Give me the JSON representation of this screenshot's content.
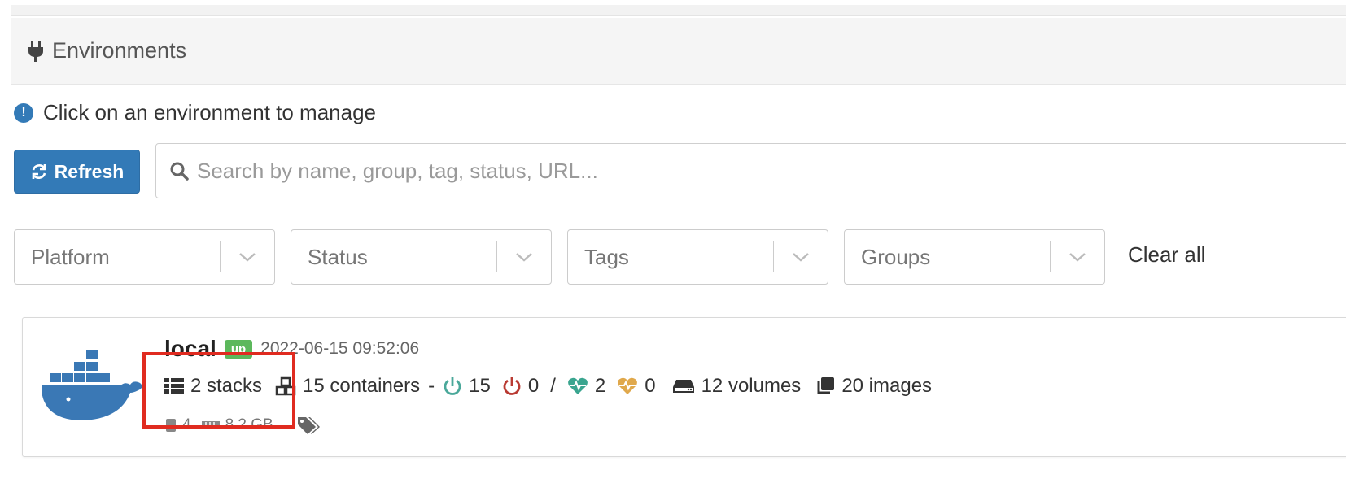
{
  "section": {
    "title": "Environments",
    "icon": "plug-icon"
  },
  "info": {
    "text": "Click on an environment to manage",
    "icon": "exclamation-circle-icon"
  },
  "toolbar": {
    "refresh_label": "Refresh",
    "search_placeholder": "Search by name, group, tag, status, URL..."
  },
  "filters": {
    "platform": "Platform",
    "status": "Status",
    "tags": "Tags",
    "groups": "Groups",
    "clear_all": "Clear all"
  },
  "environment": {
    "name": "local",
    "status": "up",
    "timestamp": "2022-06-15 09:52:06",
    "stacks": "2 stacks",
    "containers": "15 containers",
    "dash": "-",
    "running": "15",
    "stopped": "0",
    "slash": "/",
    "healthy": "2",
    "unhealthy": "0",
    "volumes": "12 volumes",
    "images": "20 images",
    "cpu": "4",
    "memory": "8.2 GB"
  },
  "colors": {
    "primary": "#337ab7",
    "success": "#5cb85c",
    "running": "#4aa89a",
    "stopped": "#b93a32",
    "healthy": "#3aa58f",
    "unhealthy": "#e0a84b",
    "highlight": "#e02b20"
  }
}
